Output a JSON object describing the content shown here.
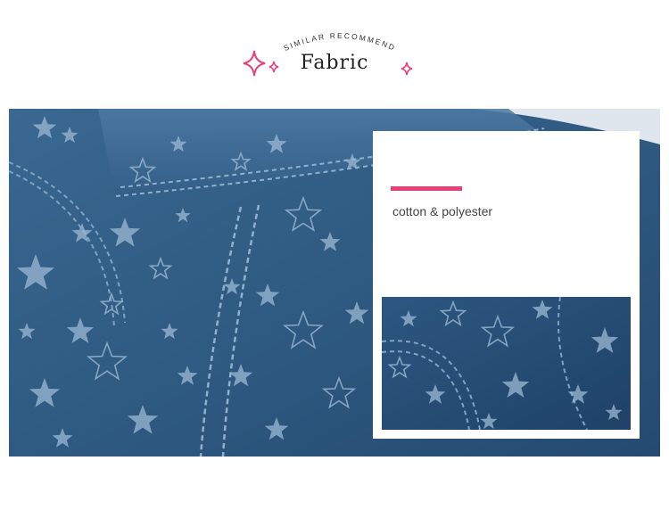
{
  "header": {
    "subtitle": "SIMILAR RECOMMEND",
    "title": "Fabric",
    "sparkle_icon": "sparkle-icon"
  },
  "colors": {
    "accent": "#e83e7a",
    "denim_dark": "#2c4f75",
    "denim_mid": "#3e6a92",
    "star": "#9bb9d4"
  },
  "card": {
    "description": "cotton & polyester"
  }
}
